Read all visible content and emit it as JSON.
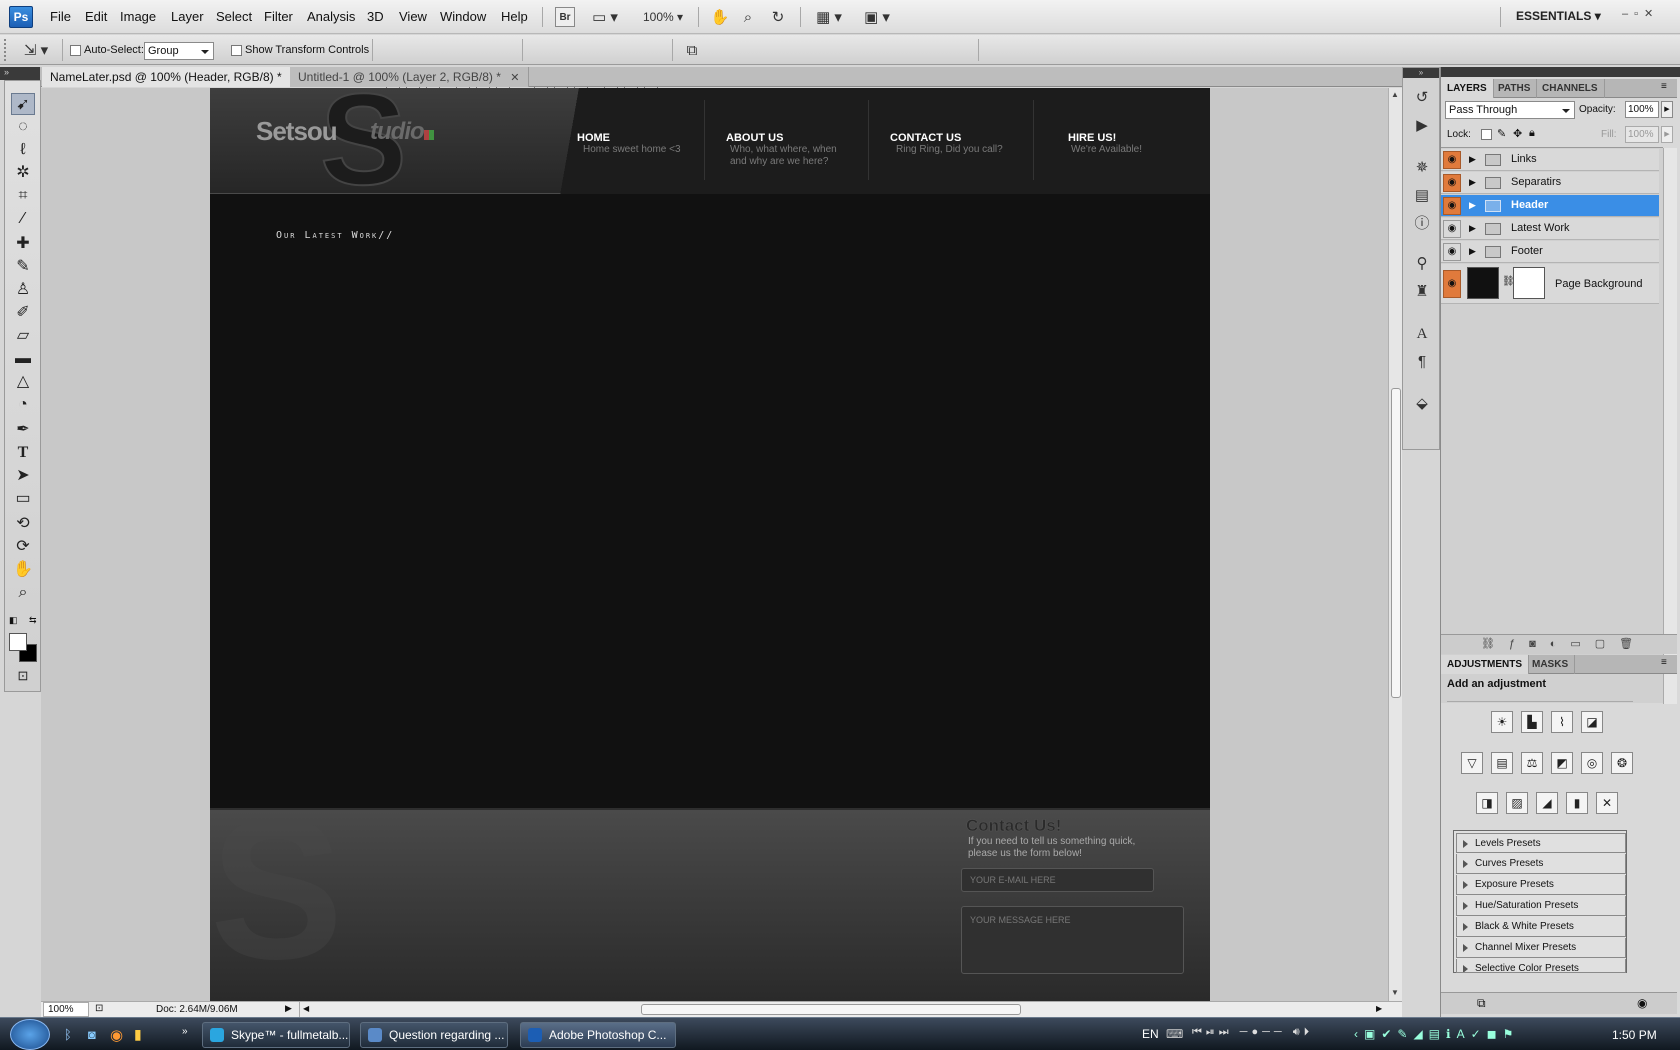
{
  "app": {
    "logo": "Ps",
    "menus": [
      "File",
      "Edit",
      "Image",
      "Layer",
      "Select",
      "Filter",
      "Analysis",
      "3D",
      "View",
      "Window",
      "Help"
    ],
    "bridge_label": "Br",
    "zoom": "100%",
    "workspace": "ESSENTIALS"
  },
  "options": {
    "auto_select_label": "Auto-Select:",
    "auto_select_value": "Group",
    "show_transform_label": "Show Transform Controls"
  },
  "doc_tabs": [
    {
      "label": "NameLater.psd @ 100% (Header, RGB/8) *"
    },
    {
      "label": "Untitled-1 @ 100% (Layer 2, RGB/8) *"
    }
  ],
  "canvas": {
    "logo_text": "Setsou",
    "logo_big_letter": "S",
    "logo_studio": "tudio",
    "nav": [
      {
        "title": "HOME",
        "sub": "Home sweet home <3"
      },
      {
        "title": "ABOUT US",
        "sub": "Who, what where, when and why are we here?"
      },
      {
        "title": "CONTACT US",
        "sub": "Ring Ring, Did you call?"
      },
      {
        "title": "HIRE US!",
        "sub": "We're Available!"
      }
    ],
    "latest_work": "Our Latest Work//",
    "contact_title": "Contact Us!",
    "contact_text": "If you need to tell us something quick, please us the form below!",
    "email_placeholder": "YOUR E-MAIL HERE",
    "message_placeholder": "YOUR MESSAGE HERE"
  },
  "status": {
    "zoom": "100%",
    "doc": "Doc: 2.64M/9.06M"
  },
  "layers_panel": {
    "tabs": [
      "LAYERS",
      "PATHS",
      "CHANNELS"
    ],
    "blend_mode": "Pass Through",
    "opacity_label": "Opacity:",
    "opacity": "100%",
    "lock_label": "Lock:",
    "fill_label": "Fill:",
    "fill": "100%",
    "layers": [
      {
        "name": "Links"
      },
      {
        "name": "Separatirs"
      },
      {
        "name": "Header"
      },
      {
        "name": "Latest Work"
      },
      {
        "name": "Footer"
      },
      {
        "name": "Page Background"
      }
    ],
    "selected_color": "#3a8ee6"
  },
  "adjustments_panel": {
    "tabs": [
      "ADJUSTMENTS",
      "MASKS"
    ],
    "title": "Add an adjustment",
    "presets": [
      "Levels Presets",
      "Curves Presets",
      "Exposure Presets",
      "Hue/Saturation Presets",
      "Black & White Presets",
      "Channel Mixer Presets",
      "Selective Color Presets"
    ]
  },
  "taskbar": {
    "buttons": [
      {
        "label": "Skype™ - fullmetalb..."
      },
      {
        "label": "Question regarding ..."
      },
      {
        "label": "Adobe Photoshop C..."
      }
    ],
    "lang": "EN",
    "time": "1:50 PM"
  },
  "colors": {
    "accent": "#3a8ee6",
    "eye_bg": "#e07a3c"
  }
}
